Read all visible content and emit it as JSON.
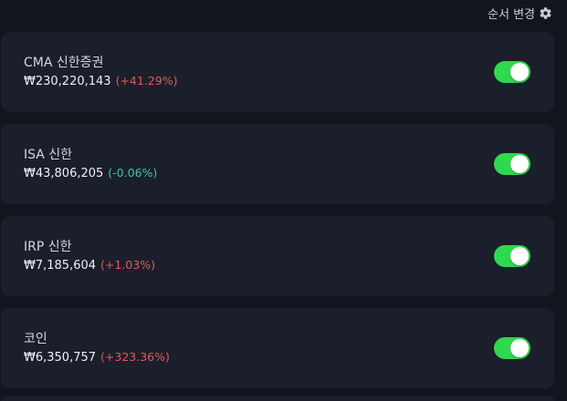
{
  "header": {
    "reorder_label": "순서 변경",
    "reorder_icon": "gear-icon"
  },
  "colors": {
    "background": "#12151e",
    "card": "#1b1f2b",
    "positive": "#e05a5a",
    "negative": "#3fc6a5",
    "toggle_on": "#2fd94e"
  },
  "accounts": [
    {
      "name": "CMA 신한증권",
      "amount": "₩230,220,143",
      "change": "(+41.29%)",
      "direction": "up",
      "enabled": true
    },
    {
      "name": "ISA 신한",
      "amount": "₩43,806,205",
      "change": "(-0.06%)",
      "direction": "down",
      "enabled": true
    },
    {
      "name": "IRP 신한",
      "amount": "₩7,185,604",
      "change": "(+1.03%)",
      "direction": "up",
      "enabled": true
    },
    {
      "name": "코인",
      "amount": "₩6,350,757",
      "change": "(+323.36%)",
      "direction": "up",
      "enabled": true
    }
  ]
}
